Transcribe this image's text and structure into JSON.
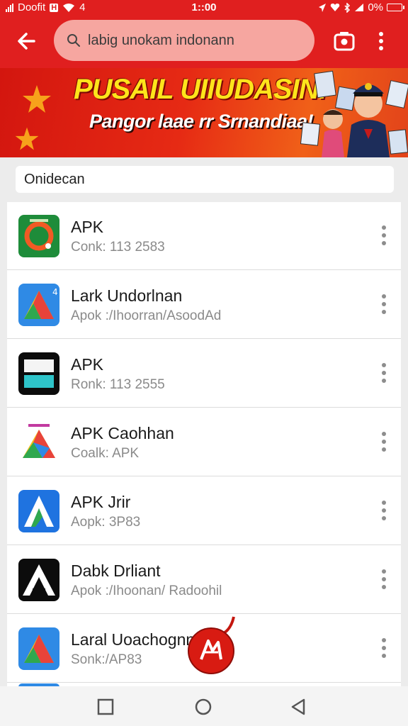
{
  "status_bar": {
    "carrier": "Doofit",
    "network_badge": "H",
    "network_extra": "4",
    "time": "1::00",
    "battery_percent": "0%"
  },
  "app_bar": {
    "search_text": "labig unokam indonann",
    "icons": [
      "back-arrow-icon",
      "search-icon",
      "camera-icon",
      "more-vert-icon"
    ]
  },
  "banner": {
    "title": "PUSAIL UIIUDASIN!",
    "subtitle": "Pangor laae rr Srnandiaa!"
  },
  "filter_label": "Onidecan",
  "apps": [
    {
      "title": "APK",
      "subtitle": "Conk: 113 2583",
      "icon": "green-circle-app-icon"
    },
    {
      "title": "Lark Undorlnan",
      "subtitle": "Apok :/Ihoorran/AsoodAd",
      "icon": "blue-triangle-app-icon"
    },
    {
      "title": "APK",
      "subtitle": "Ronk: 113 2555",
      "icon": "black-onai-app-icon"
    },
    {
      "title": "APK Caohhan",
      "subtitle": "Coalk: APK",
      "icon": "triangle-app-icon"
    },
    {
      "title": "APK Jrir",
      "subtitle": "Aopk: 3P83",
      "icon": "blue-a-app-icon"
    },
    {
      "title": "Dabk Drliant",
      "subtitle": "Apok :/Ihoonan/ Radoohil",
      "icon": "black-a-app-icon"
    },
    {
      "title": "Laral Uoachognn",
      "subtitle": "Sonk:/AP83",
      "icon": "blue-triangle-app-icon"
    }
  ],
  "colors": {
    "primary_red": "#e01f1f",
    "search_pill": "#f6a6a0",
    "banner_yellow": "#ffe41b"
  }
}
